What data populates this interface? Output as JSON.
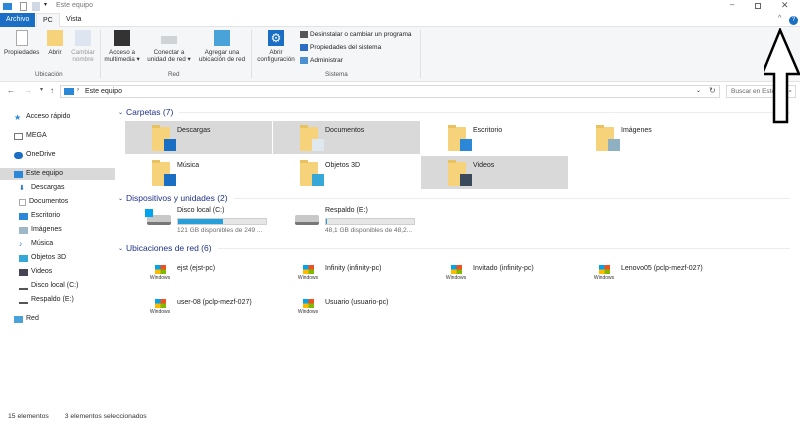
{
  "window": {
    "title": "Este equipo"
  },
  "tabs": [
    {
      "label": "Archivo"
    },
    {
      "label": "PC"
    },
    {
      "label": "Vista"
    }
  ],
  "ribbon": {
    "ubicacion": {
      "label": "Ubicación",
      "buttons": [
        {
          "label": "Propiedades"
        },
        {
          "label": "Abrir"
        },
        {
          "label": "Cambiar nombre"
        }
      ]
    },
    "red": {
      "label": "Red",
      "buttons": [
        {
          "label": "Acceso a multimedia"
        },
        {
          "label": "Conectar a unidad de red"
        },
        {
          "label": "Agregar una ubicación de red"
        }
      ]
    },
    "sistema": {
      "label": "Sistema",
      "open_settings": "Abrir configuración",
      "items": [
        {
          "label": "Desinstalar o cambiar un programa"
        },
        {
          "label": "Propiedades del sistema"
        },
        {
          "label": "Administrar"
        }
      ]
    }
  },
  "address": {
    "path": "Este equipo"
  },
  "search": {
    "placeholder": "Buscar en Este..."
  },
  "sidebar": {
    "items": [
      {
        "label": "Acceso rápido",
        "icon": "star-icon"
      },
      {
        "label": "MEGA",
        "icon": "mega-icon"
      },
      {
        "label": "OneDrive",
        "icon": "cloud-icon"
      },
      {
        "label": "Este equipo",
        "icon": "computer-icon",
        "selected": true
      },
      {
        "label": "Descargas",
        "icon": "download-icon"
      },
      {
        "label": "Documentos",
        "icon": "document-icon"
      },
      {
        "label": "Escritorio",
        "icon": "desktop-icon"
      },
      {
        "label": "Imágenes",
        "icon": "image-icon"
      },
      {
        "label": "Música",
        "icon": "music-icon"
      },
      {
        "label": "Objetos 3D",
        "icon": "cube-icon"
      },
      {
        "label": "Videos",
        "icon": "video-icon"
      },
      {
        "label": "Disco local (C:)",
        "icon": "drive-icon"
      },
      {
        "label": "Respaldo (E:)",
        "icon": "drive-icon"
      },
      {
        "label": "Red",
        "icon": "network-icon"
      }
    ]
  },
  "sections": {
    "folders": {
      "title": "Carpetas (7)",
      "items": [
        {
          "name": "Descargas",
          "selected": true
        },
        {
          "name": "Documentos",
          "selected": true
        },
        {
          "name": "Escritorio",
          "selected": false
        },
        {
          "name": "Imágenes",
          "selected": false
        },
        {
          "name": "Música",
          "selected": false
        },
        {
          "name": "Objetos 3D",
          "selected": false
        },
        {
          "name": "Videos",
          "selected": true
        }
      ]
    },
    "drives": {
      "title": "Dispositivos y unidades (2)",
      "items": [
        {
          "name": "Disco local (C:)",
          "space": "121 GB disponibles de 249 ...",
          "used_percent": 51
        },
        {
          "name": "Respaldo (E:)",
          "space": "48,1 GB disponibles de 48,2...",
          "used_percent": 0.2
        }
      ]
    },
    "network": {
      "title": "Ubicaciones de red (6)",
      "items": [
        {
          "name": "ejst (ejst-pc)"
        },
        {
          "name": "Infinity (infinity-pc)"
        },
        {
          "name": "Invitado (infinity-pc)"
        },
        {
          "name": "Lenovo05 (pclp-mezf-027)"
        },
        {
          "name": "user-08 (pclp-mezf-027)"
        },
        {
          "name": "Usuario (usuario-pc)"
        }
      ]
    },
    "wmp_label": "Windows"
  },
  "status": {
    "count": "15 elementos",
    "selected": "3 elementos seleccionados"
  },
  "colors": {
    "accent": "#1a6fc4",
    "selection": "#d9d9d9",
    "section_title": "#1e3287",
    "disk_bar": "#26a0da"
  }
}
